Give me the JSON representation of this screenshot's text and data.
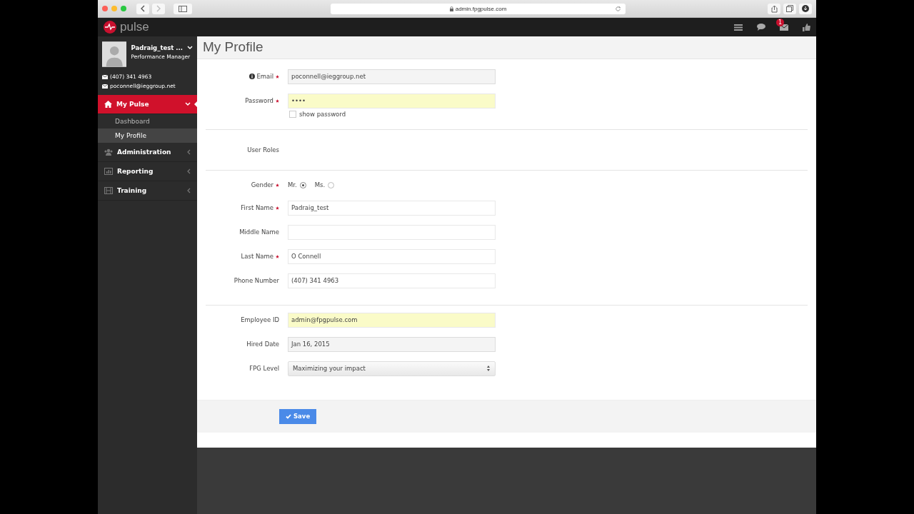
{
  "browser": {
    "url": "admin.fpgpulse.com"
  },
  "app": {
    "logo": "pulse",
    "notification_count": "1"
  },
  "user": {
    "name": "Padraig_test ...",
    "role": "Performance Manager",
    "phone": "(407) 341 4963",
    "email": "poconnell@ieggroup.net"
  },
  "nav": [
    {
      "label": "My Pulse",
      "expanded": true,
      "children": [
        {
          "label": "Dashboard",
          "selected": false
        },
        {
          "label": "My Profile",
          "selected": true
        }
      ]
    },
    {
      "label": "Administration",
      "expanded": false
    },
    {
      "label": "Reporting",
      "expanded": false
    },
    {
      "label": "Training",
      "expanded": false
    }
  ],
  "page": {
    "title": "My Profile"
  },
  "sections": [
    [
      {
        "kind": "text",
        "label": "Email",
        "info": true,
        "required": true,
        "value": "poconnell@ieggroup.net",
        "readonly": true,
        "autofilled": false
      },
      {
        "kind": "password",
        "label": "Password",
        "required": true,
        "value": "••••",
        "readonly": false,
        "autofilled": true,
        "show_label": "show password",
        "show_checked": false
      }
    ],
    [
      {
        "kind": "none",
        "label": "User Roles",
        "required": false
      }
    ],
    [
      {
        "kind": "radio",
        "label": "Gender",
        "required": true,
        "options": [
          {
            "label": "Mr.",
            "selected": true
          },
          {
            "label": "Ms.",
            "selected": false
          }
        ]
      },
      {
        "kind": "text",
        "label": "First Name",
        "required": true,
        "value": "Padraig_test",
        "readonly": false,
        "autofilled": false
      },
      {
        "kind": "text",
        "label": "Middle Name",
        "required": false,
        "readonly": false,
        "autofilled": false
      },
      {
        "kind": "text",
        "label": "Last Name",
        "required": true,
        "value": "O Connell",
        "readonly": false,
        "autofilled": false
      },
      {
        "kind": "text",
        "label": "Phone Number",
        "required": false,
        "value": "(407) 341 4963",
        "readonly": false,
        "autofilled": false
      }
    ],
    [
      {
        "kind": "text",
        "label": "Employee ID",
        "required": false,
        "value": "admin@fpgpulse.com",
        "readonly": false,
        "autofilled": true
      },
      {
        "kind": "text",
        "label": "Hired Date",
        "required": false,
        "value": "Jan 16, 2015",
        "readonly": true,
        "autofilled": false
      },
      {
        "kind": "select",
        "label": "FPG Level",
        "required": false,
        "value": "Maximizing your impact"
      }
    ]
  ],
  "save_button": "Save"
}
